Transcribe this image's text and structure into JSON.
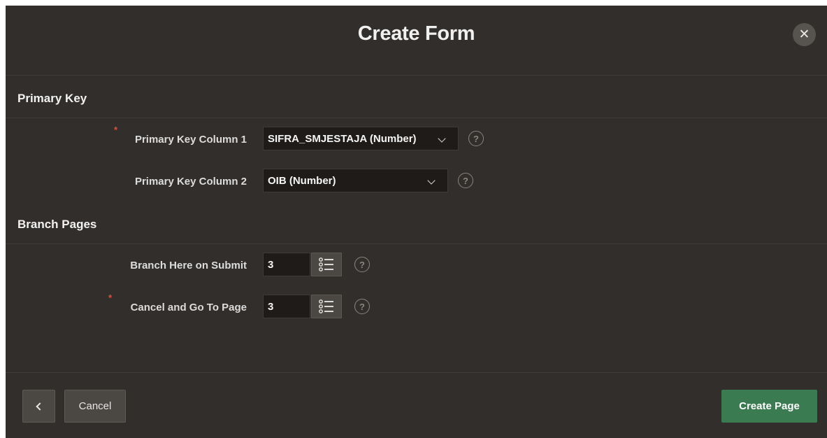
{
  "dialog": {
    "title": "Create Form",
    "close_label": "✕"
  },
  "primary_key": {
    "heading": "Primary Key",
    "column1": {
      "label": "Primary Key Column 1",
      "required": true,
      "value": "SIFRA_SMJESTAJA (Number)"
    },
    "column2": {
      "label": "Primary Key Column 2",
      "required": false,
      "value": "OIB (Number)"
    }
  },
  "branch_pages": {
    "heading": "Branch Pages",
    "submit": {
      "label": "Branch Here on Submit",
      "required": false,
      "value": "3"
    },
    "cancel": {
      "label": "Cancel and Go To Page",
      "required": true,
      "value": "3"
    }
  },
  "help_glyph": "?",
  "required_marker": "*",
  "footer": {
    "cancel_label": "Cancel",
    "create_label": "Create Page"
  },
  "colors": {
    "background": "#322e2b",
    "input_bg": "#1e1b19",
    "primary_button": "#3a7b51",
    "required": "#e0503a"
  },
  "icons": [
    "close-icon",
    "chevron-down-icon",
    "help-icon",
    "list-icon",
    "chevron-left-icon"
  ]
}
